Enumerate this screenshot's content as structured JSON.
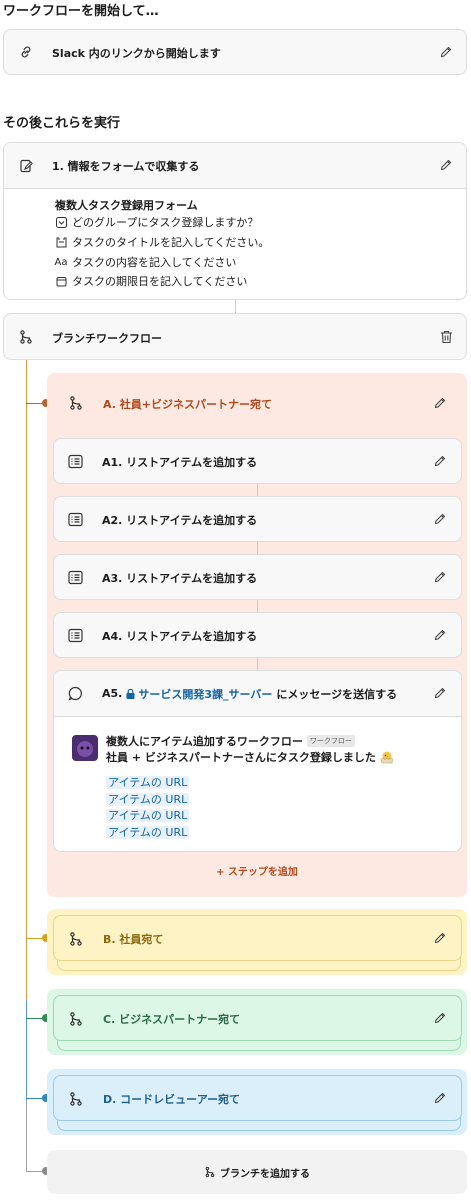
{
  "start_heading": "ワークフローを開始して…",
  "trigger": {
    "label": "Slack 内のリンクから開始します"
  },
  "then_heading": "その後これらを実行",
  "step1": {
    "title": "1. 情報をフォームで収集する",
    "form_title": "複数人タスク登録用フォーム",
    "fields": [
      {
        "icon": "dropdown-icon",
        "text": "どのグループにタスク登録しますか？"
      },
      {
        "icon": "short-text-icon",
        "text": "タスクのタイトルを記入してください。"
      },
      {
        "icon": "text-aa-icon",
        "text": "タスクの内容を記入してください"
      },
      {
        "icon": "calendar-icon",
        "text": "タスクの期限日を記入してください"
      }
    ]
  },
  "branch": {
    "title": "ブランチワークフロー",
    "branches": [
      {
        "label": "A. 社員+ビジネスパートナー宛て",
        "color": "#c0622d",
        "steps": [
          "A1. リストアイテムを追加する",
          "A2. リストアイテムを追加する",
          "A3. リストアイテムを追加する",
          "A4. リストアイテムを追加する"
        ],
        "message_step": {
          "prefix": "A5.",
          "channel": "サービス開発3課_サーバー",
          "suffix": "にメッセージを送信する",
          "bot_name": "複数人にアイテム追加するワークフロー",
          "bot_tag": "ワークフロー",
          "body": "社員 + ビジネスパートナーさんにタスク登録しました",
          "links": [
            "アイテムの URL",
            "アイテムの URL",
            "アイテムの URL",
            "アイテムの URL"
          ]
        },
        "add_step": "+ ステップを追加"
      },
      {
        "label": "B. 社員宛て",
        "color": "#d8a21e"
      },
      {
        "label": "C. ビジネスパートナー宛て",
        "color": "#2e8b57"
      },
      {
        "label": "D. コードレビューアー宛て",
        "color": "#2f88c9"
      }
    ],
    "add_branch": "ブランチを追加する"
  }
}
